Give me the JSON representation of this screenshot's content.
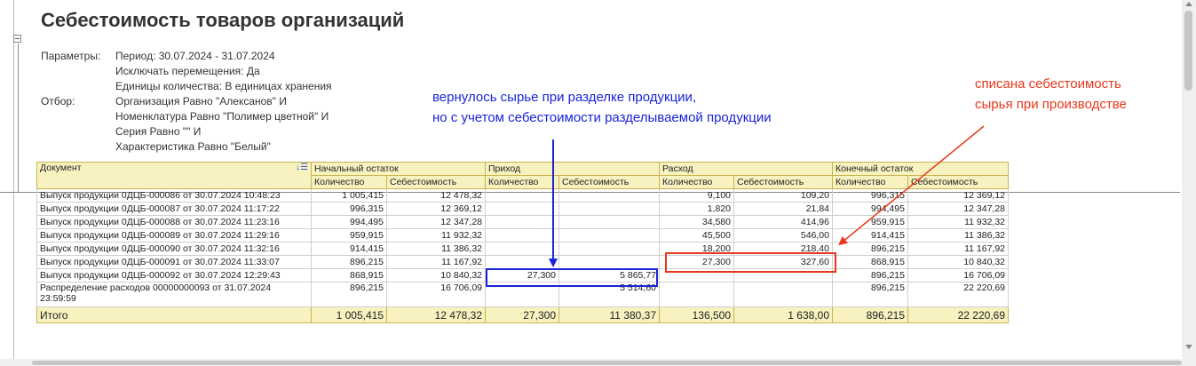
{
  "report": {
    "title": "Себестоимость товаров организаций",
    "params_label": "Параметры:",
    "params": [
      "Период: 30.07.2024 - 31.07.2024",
      "Исключать перемещения: Да",
      "Единицы количества: В единицах хранения"
    ],
    "filter_label": "Отбор:",
    "filters": [
      "Организация Равно \"Алексанов\" И",
      "Номенклатура Равно \"Полимер цветной\" И",
      "Серия Равно \"\" И",
      "Характеристика Равно \"Белый\""
    ]
  },
  "annotations": {
    "blue": [
      "вернулось сырье при разделке продукции,",
      "но с учетом себестоимости разделываемой продукции"
    ],
    "red": [
      "списана себестоимость",
      "сырья при производстве"
    ],
    "blue_color": "#1a24d6",
    "red_color": "#e8371c"
  },
  "table": {
    "col_document": "Документ",
    "groups": [
      "Начальный остаток",
      "Приход",
      "Расход",
      "Конечный остаток"
    ],
    "subheaders": [
      "Количество",
      "Себестоимость",
      "Количество",
      "Себестоимость",
      "Количество",
      "Себестоимость",
      "Количество",
      "Себестоимость"
    ],
    "rows": [
      {
        "doc": "Выпуск продукции 0ДЦБ-000086 от 30.07.2024 10:48:23",
        "c1": "1 005,415",
        "c2": "12 478,32",
        "c3": "",
        "c4": "",
        "c5": "9,100",
        "c6": "109,20",
        "c7": "996,315",
        "c8": "12 369,12"
      },
      {
        "doc": "Выпуск продукции 0ДЦБ-000087 от 30.07.2024 11:17:22",
        "c1": "996,315",
        "c2": "12 369,12",
        "c3": "",
        "c4": "",
        "c5": "1,820",
        "c6": "21,84",
        "c7": "994,495",
        "c8": "12 347,28"
      },
      {
        "doc": "Выпуск продукции 0ДЦБ-000088 от 30.07.2024 11:23:16",
        "c1": "994,495",
        "c2": "12 347,28",
        "c3": "",
        "c4": "",
        "c5": "34,580",
        "c6": "414,96",
        "c7": "959,915",
        "c8": "11 932,32"
      },
      {
        "doc": "Выпуск продукции 0ДЦБ-000089 от 30.07.2024 11:29:16",
        "c1": "959,915",
        "c2": "11 932,32",
        "c3": "",
        "c4": "",
        "c5": "45,500",
        "c6": "546,00",
        "c7": "914,415",
        "c8": "11 386,32"
      },
      {
        "doc": "Выпуск продукции 0ДЦБ-000090 от 30.07.2024 11:32:16",
        "c1": "914,415",
        "c2": "11 386,32",
        "c3": "",
        "c4": "",
        "c5": "18,200",
        "c6": "218,40",
        "c7": "896,215",
        "c8": "11 167,92"
      },
      {
        "doc": "Выпуск продукции 0ДЦБ-000091 от 30.07.2024 11:33:07",
        "c1": "896,215",
        "c2": "11 167,92",
        "c3": "",
        "c4": "",
        "c5": "27,300",
        "c6": "327,60",
        "c7": "868,915",
        "c8": "10 840,32"
      },
      {
        "doc": "Выпуск продукции 0ДЦБ-000092 от 30.07.2024 12:29:43",
        "c1": "868,915",
        "c2": "10 840,32",
        "c3": "27,300",
        "c4": "5 865,77",
        "c5": "",
        "c6": "",
        "c7": "896,215",
        "c8": "16 706,09"
      }
    ],
    "last_row": {
      "doc_line1": "Распределение расходов 00000000093 от 31.07.2024",
      "doc_line2": "23:59:59",
      "c1": "896,215",
      "c2": "16 706,09",
      "c3": "",
      "c4": "5 514,60",
      "c5": "",
      "c6": "",
      "c7": "896,215",
      "c8": "22 220,69"
    },
    "total": {
      "label": "Итого",
      "c1": "1 005,415",
      "c2": "12 478,32",
      "c3": "27,300",
      "c4": "11 380,37",
      "c5": "136,500",
      "c6": "1 638,00",
      "c7": "896,215",
      "c8": "22 220,69"
    }
  }
}
